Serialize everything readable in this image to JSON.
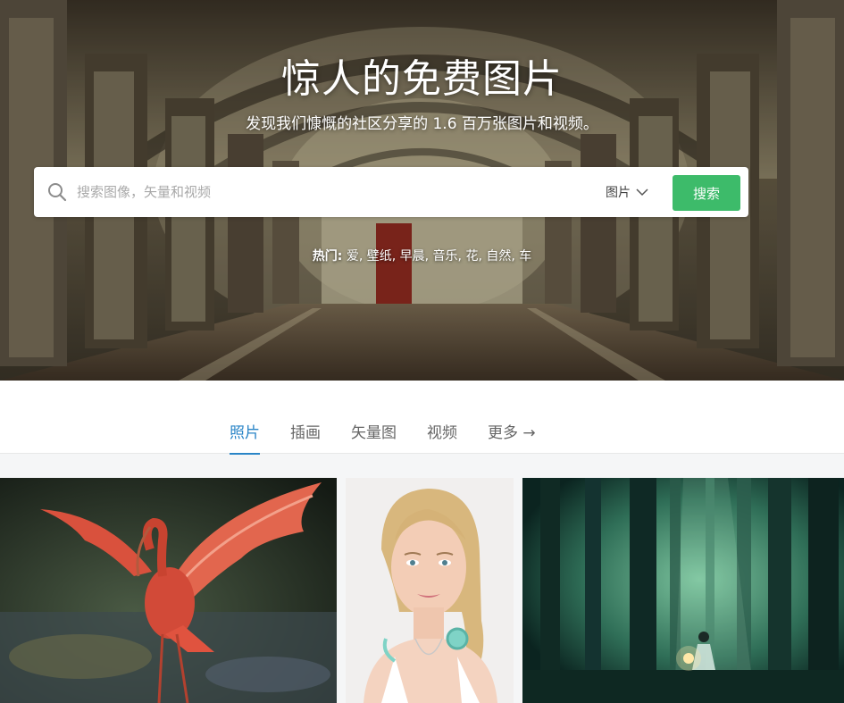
{
  "hero": {
    "title": "惊人的免费图片",
    "subtitle": "发现我们慷慨的社区分享的 1.6 百万张图片和视频。"
  },
  "search": {
    "placeholder": "搜索图像，矢量和视频",
    "type_label": "图片",
    "button_label": "搜索"
  },
  "popular": {
    "label": "热门:",
    "tags": [
      "爱",
      "壁纸",
      "早晨",
      "音乐",
      "花",
      "自然",
      "车"
    ]
  },
  "tabs": [
    {
      "label": "照片",
      "active": true
    },
    {
      "label": "插画",
      "active": false
    },
    {
      "label": "矢量图",
      "active": false
    },
    {
      "label": "视频",
      "active": false
    },
    {
      "label": "更多 →",
      "active": false
    }
  ],
  "colors": {
    "accent": "#2a85c7",
    "search_button": "#3dbb6a"
  },
  "gallery": [
    {
      "subject": "scarlet ibis with spread wings in water"
    },
    {
      "subject": "portrait of blonde woman with headphones"
    },
    {
      "subject": "girl holding a lantern in a misty green forest"
    }
  ]
}
